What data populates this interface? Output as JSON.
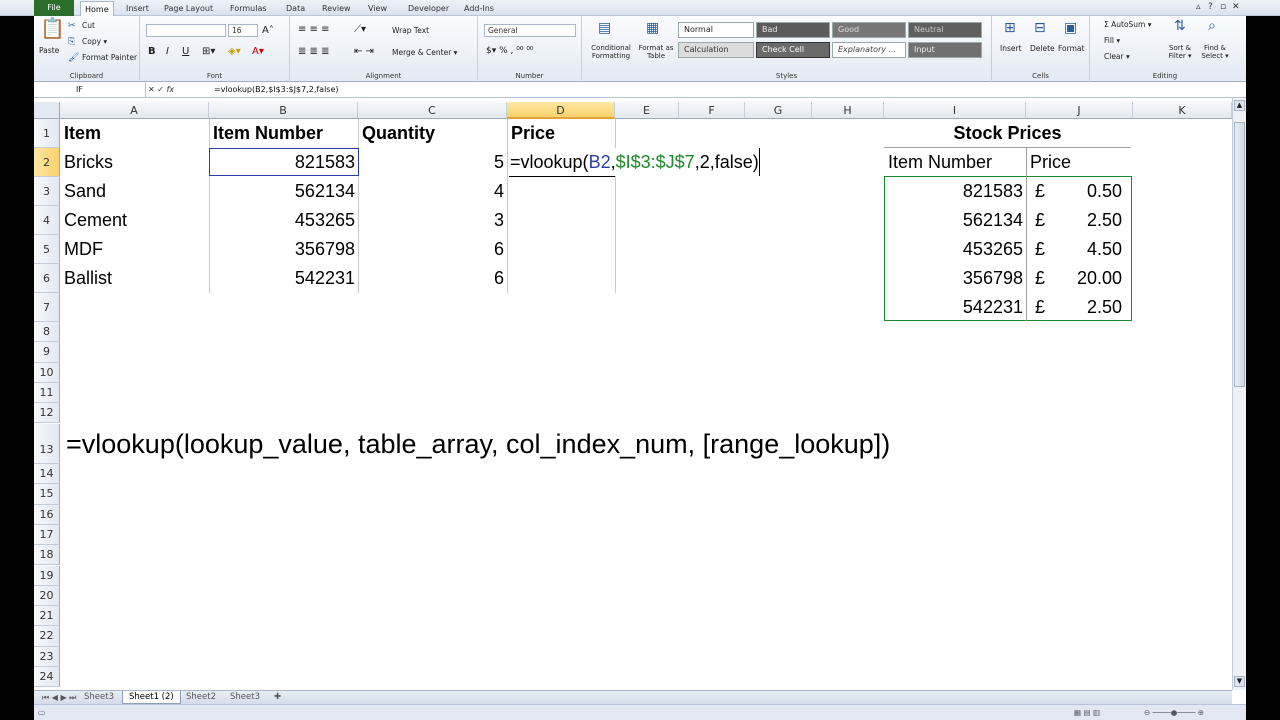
{
  "tabs": {
    "file": "File",
    "items": [
      "Home",
      "Insert",
      "Page Layout",
      "Formulas",
      "Data",
      "Review",
      "View",
      "Developer",
      "Add-Ins"
    ]
  },
  "ribbon": {
    "clipboard": {
      "paste": "Paste",
      "cut": "Cut",
      "copy": "Copy ▾",
      "format_painter": "Format Painter",
      "label": "Clipboard"
    },
    "font": {
      "name": "",
      "size": "16",
      "bold": "B",
      "italic": "I",
      "underline": "U",
      "label": "Font"
    },
    "alignment": {
      "wrap": "Wrap Text",
      "merge": "Merge & Center ▾",
      "label": "Alignment"
    },
    "number": {
      "format": "General",
      "label": "Number"
    },
    "styles": {
      "conditional": "Conditional Formatting",
      "format_table": "Format as Table",
      "normal": "Normal",
      "bad": "Bad",
      "good": "Good",
      "neutral": "Neutral",
      "calculation": "Calculation",
      "check_cell": "Check Cell",
      "explanatory": "Explanatory ...",
      "input": "Input",
      "label": "Styles"
    },
    "cells": {
      "insert": "Insert",
      "delete": "Delete",
      "format": "Format",
      "label": "Cells"
    },
    "editing": {
      "autosum": "Σ AutoSum ▾",
      "fill": "Fill ▾",
      "clear": "Clear ▾",
      "sort": "Sort & Filter ▾",
      "find": "Find & Select ▾",
      "label": "Editing"
    }
  },
  "formula_bar": {
    "name_box": "IF",
    "content": "=vlookup(B2,$I$3:$J$7,2,false)"
  },
  "columns": [
    "A",
    "B",
    "C",
    "D",
    "E",
    "F",
    "G",
    "H",
    "I",
    "J",
    "K"
  ],
  "rows": [
    "1",
    "2",
    "3",
    "4",
    "5",
    "6",
    "7",
    "8",
    "9",
    "10",
    "11",
    "12",
    "13",
    "14",
    "15",
    "16",
    "17",
    "18",
    "19",
    "20",
    "21",
    "22",
    "23",
    "24"
  ],
  "table": {
    "headers": {
      "item": "Item",
      "item_number": "Item Number",
      "quantity": "Quantity",
      "price": "Price"
    },
    "rows": [
      {
        "item": "Bricks",
        "number": "821583",
        "qty": "5"
      },
      {
        "item": "Sand",
        "number": "562134",
        "qty": "4"
      },
      {
        "item": "Cement",
        "number": "453265",
        "qty": "3"
      },
      {
        "item": "MDF",
        "number": "356798",
        "qty": "6"
      },
      {
        "item": "Ballist",
        "number": "542231",
        "qty": "6"
      }
    ]
  },
  "editing_cell": {
    "prefix": "=vlookup(",
    "ref1": "B2",
    "sep": ",",
    "ref2": "$I$3:$J$7",
    "suffix": ",2,false)"
  },
  "stock": {
    "title": "Stock Prices",
    "header_number": "Item Number",
    "header_price": "Price",
    "currency": "£",
    "rows": [
      {
        "number": "821583",
        "price": "0.50"
      },
      {
        "number": "562134",
        "price": "2.50"
      },
      {
        "number": "453265",
        "price": "4.50"
      },
      {
        "number": "356798",
        "price": "20.00"
      },
      {
        "number": "542231",
        "price": "2.50"
      }
    ]
  },
  "syntax_text": "=vlookup(lookup_value, table_array, col_index_num, [range_lookup])",
  "sheets": [
    "Sheet3",
    "Sheet1 (2)",
    "Sheet2",
    "Sheet3"
  ],
  "colors": {
    "file_tab": "#2b6e2b",
    "selected_header": "#f9d26a",
    "range_green": "#1d8a2a",
    "range_blue": "#2a3fa8"
  }
}
